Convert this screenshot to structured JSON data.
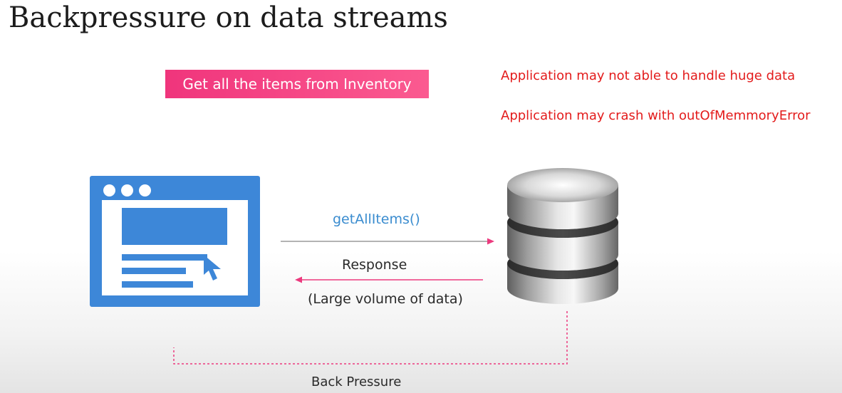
{
  "slide": {
    "title": "Backpressure on data streams",
    "request_badge": "Get all the items from Inventory",
    "warnings": [
      "Application may not able to handle huge data",
      "Application may crash with outOfMemmoryError"
    ]
  },
  "flow": {
    "request_label": "getAllItems()",
    "response_label": "Response",
    "response_detail": "(Large volume of data)",
    "backpressure_label": "Back Pressure"
  },
  "colors": {
    "badge": "#f0357c",
    "warning": "#e31b1b",
    "client_blue": "#3d87d8",
    "arrow_pink": "#ec3a7e",
    "arrow_grey": "#9a9a9a",
    "request_text": "#3a8ccf"
  },
  "icons": {
    "client": "browser-window-icon",
    "server": "database-icon",
    "pointer": "cursor-arrow-icon"
  }
}
